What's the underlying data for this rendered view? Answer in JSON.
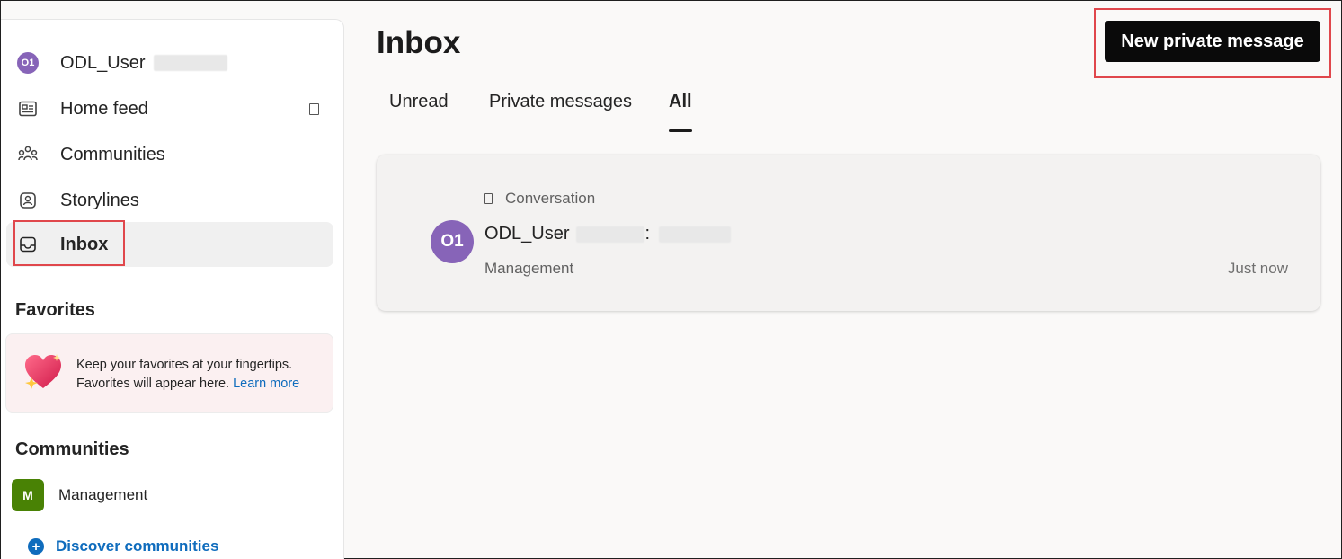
{
  "sidebar": {
    "user": {
      "avatar_initials": "O1",
      "name": "ODL_User"
    },
    "items": [
      {
        "label": "Home feed",
        "icon": "home-feed-icon"
      },
      {
        "label": "Communities",
        "icon": "communities-icon"
      },
      {
        "label": "Storylines",
        "icon": "storylines-icon"
      },
      {
        "label": "Inbox",
        "icon": "inbox-icon"
      }
    ],
    "favorites": {
      "title": "Favorites",
      "message_line1": "Keep your favorites at your fingertips.",
      "message_line2": "Favorites will appear here.",
      "learn_more": "Learn more"
    },
    "communities": {
      "title": "Communities",
      "items": [
        {
          "badge": "M",
          "name": "Management"
        }
      ],
      "discover_label": "Discover communities"
    }
  },
  "main": {
    "title": "Inbox",
    "new_message_label": "New private message",
    "tabs": [
      {
        "label": "Unread"
      },
      {
        "label": "Private messages"
      },
      {
        "label": "All"
      }
    ],
    "conversation": {
      "kind": "Conversation",
      "avatar_initials": "O1",
      "sender": "ODL_User",
      "separator": ":",
      "community": "Management",
      "time": "Just now"
    }
  },
  "colors": {
    "accent": "#0f6cbd",
    "avatar": "#8764b8",
    "community_badge": "#498205",
    "highlight": "#e0474c"
  }
}
